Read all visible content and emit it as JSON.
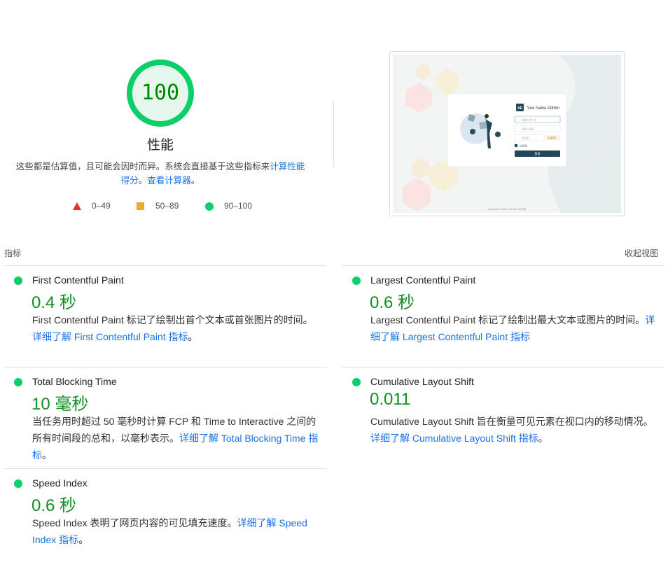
{
  "score": {
    "value": "100",
    "fraction": 1.0,
    "title": "性能",
    "desc_text": "这些都是估算值，且可能会因时而异。系统会直接基于这些指标来",
    "desc_link1": "计算性能得分",
    "desc_sep": "。",
    "desc_link2": "查看计算器",
    "desc_end": "。",
    "colors": {
      "pass": "#0cce6b",
      "pass_bg": "#e6f8ee",
      "pass_text": "#008800"
    }
  },
  "legend": [
    {
      "range": "0–49",
      "shape": "triangle",
      "color": "#eb3223"
    },
    {
      "range": "50–89",
      "shape": "square",
      "color": "#f4a832"
    },
    {
      "range": "90–100",
      "shape": "circle",
      "color": "#0cce6b"
    }
  ],
  "screenshot": {
    "app_name": "Vue Naive Admin",
    "logo_text": "AE",
    "username_placeholder": "请输入用户名",
    "password_placeholder": "请输入密码",
    "captcha_placeholder": "验证码",
    "captcha_text": "k4S5",
    "remember_label": "记住我",
    "login_button": "登录",
    "footer": "Copyright © 2022 Lanniven 不可用"
  },
  "metrics_header": {
    "label": "指标",
    "collapse": "收起视图"
  },
  "metrics": {
    "fcp": {
      "title": "First Contentful Paint",
      "value": "0.4 秒",
      "desc": "First Contentful Paint 标记了绘制出首个文本或首张图片的时间。",
      "link": "详细了解 First Contentful Paint 指标",
      "end": "。"
    },
    "lcp": {
      "title": "Largest Contentful Paint",
      "value": "0.6 秒",
      "desc": "Largest Contentful Paint 标记了绘制出最大文本或图片的时间。",
      "link": "详细了解 Largest Contentful Paint 指标",
      "end": ""
    },
    "tbt": {
      "title": "Total Blocking Time",
      "value": "10 毫秒",
      "desc": "当任务用时超过 50 毫秒时计算 FCP 和 Time to Interactive 之间的所有时间段的总和，以毫秒表示。",
      "link": "详细了解 Total Blocking Time 指标",
      "end": "。"
    },
    "cls": {
      "title": "Cumulative Layout Shift",
      "value": "0.011",
      "desc": "Cumulative Layout Shift 旨在衡量可见元素在视口内的移动情况。",
      "link": "详细了解 Cumulative Layout Shift 指标",
      "end": "。"
    },
    "si": {
      "title": "Speed Index",
      "value": "0.6 秒",
      "desc": "Speed Index 表明了网页内容的可见填充速度。",
      "link": "详细了解 Speed Index 指标",
      "end": "。"
    }
  }
}
